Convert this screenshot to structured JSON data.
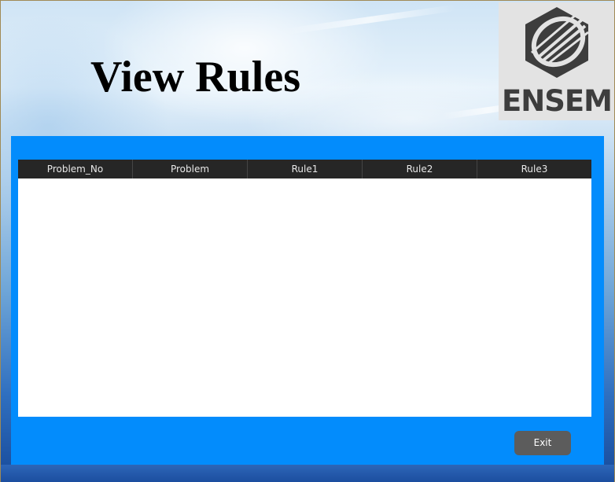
{
  "page": {
    "title": "View Rules"
  },
  "logo": {
    "text": "ENSEM",
    "icon": "ensem-globe-icon"
  },
  "table": {
    "columns": [
      "Problem_No",
      "Problem",
      "Rule1",
      "Rule2",
      "Rule3"
    ],
    "rows": []
  },
  "actions": {
    "exit_label": "Exit"
  },
  "colors": {
    "panel": "#038cfc",
    "header": "#262626",
    "button": "#5c5c5c"
  }
}
